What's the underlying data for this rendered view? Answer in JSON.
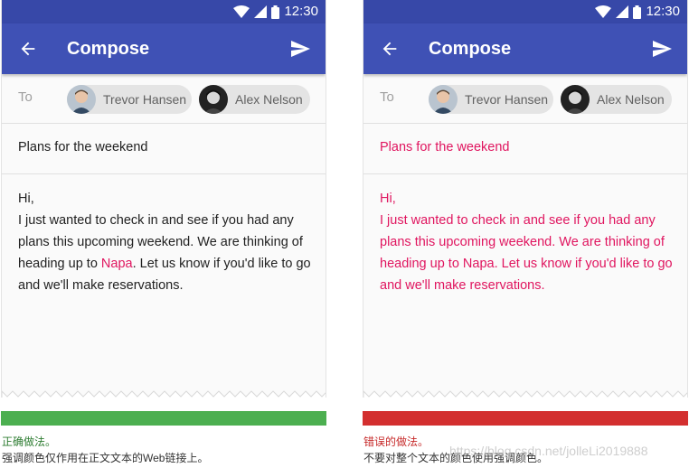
{
  "colors": {
    "status_bar": "#3748a8",
    "app_bar": "#3f51b5",
    "accent": "#e0155f",
    "correct_bar": "#4caf50",
    "wrong_bar": "#d32f2f",
    "correct_text": "#2e7d32",
    "wrong_text": "#c62828"
  },
  "status_bar": {
    "time": "12:30",
    "icons": [
      "wifi-icon",
      "cellular-icon",
      "battery-icon"
    ]
  },
  "app_bar": {
    "back_icon": "arrow-back-icon",
    "title": "Compose",
    "send_icon": "send-icon"
  },
  "to_label": "To",
  "recipients": [
    {
      "name": "Trevor Hansen",
      "avatar": "avatar"
    },
    {
      "name": "Alex Nelson",
      "avatar": "avatar"
    }
  ],
  "subject": "Plans for the weekend",
  "body": {
    "greeting": "Hi,",
    "before_link": "I just wanted to check in and see if you had any plans this upcoming weekend. We are thinking of heading up to ",
    "link": "Napa",
    "after_link": ". Let us know if you'd like to go and we'll make reservations."
  },
  "examples": {
    "correct": {
      "title": "正确做法。",
      "description": "强调颜色仅作用在正文文本的Web链接上。"
    },
    "wrong": {
      "title": "错误的做法。",
      "description": "不要对整个文本的颜色使用强调颜色。"
    }
  },
  "watermark": "https://blog.csdn.net/jolleLi2019888"
}
